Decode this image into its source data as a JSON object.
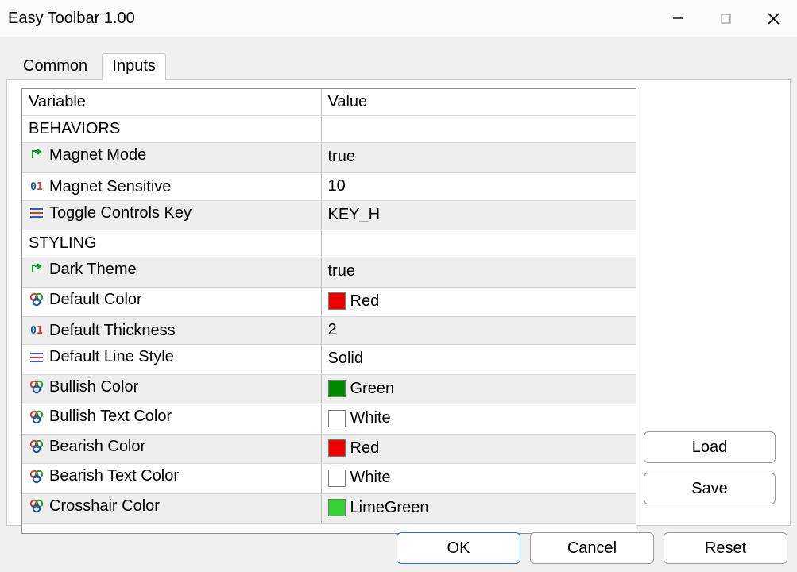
{
  "window": {
    "title": "Easy Toolbar 1.00"
  },
  "tabs": {
    "common": "Common",
    "inputs": "Inputs",
    "active": "inputs"
  },
  "headers": {
    "variable": "Variable",
    "value": "Value"
  },
  "sections": {
    "behaviors": "BEHAVIORS",
    "styling": "STYLING"
  },
  "rows": {
    "magnet_mode": {
      "label": "Magnet Mode",
      "value": "true",
      "type": "bool"
    },
    "magnet_sensitive": {
      "label": "Magnet Sensitive",
      "value": "10",
      "type": "int"
    },
    "toggle_key": {
      "label": "Toggle Controls Key",
      "value": "KEY_H",
      "type": "enum"
    },
    "dark_theme": {
      "label": "Dark Theme",
      "value": "true",
      "type": "bool"
    },
    "default_color": {
      "label": "Default Color",
      "value": "Red",
      "type": "color",
      "swatch": "#ed0000"
    },
    "default_thickness": {
      "label": "Default Thickness",
      "value": "2",
      "type": "int"
    },
    "default_linestyle": {
      "label": "Default Line Style",
      "value": "Solid",
      "type": "enum"
    },
    "bullish_color": {
      "label": "Bullish Color",
      "value": "Green",
      "type": "color",
      "swatch": "#008a00"
    },
    "bullish_text": {
      "label": "Bullish Text Color",
      "value": "White",
      "type": "color",
      "swatch": "#ffffff"
    },
    "bearish_color": {
      "label": "Bearish Color",
      "value": "Red",
      "type": "color",
      "swatch": "#ed0000"
    },
    "bearish_text": {
      "label": "Bearish Text Color",
      "value": "White",
      "type": "color",
      "swatch": "#ffffff"
    },
    "crosshair_color": {
      "label": "Crosshair Color",
      "value": "LimeGreen",
      "type": "color",
      "swatch": "#34d334"
    }
  },
  "buttons": {
    "load": "Load",
    "save": "Save",
    "ok": "OK",
    "cancel": "Cancel",
    "reset": "Reset"
  }
}
